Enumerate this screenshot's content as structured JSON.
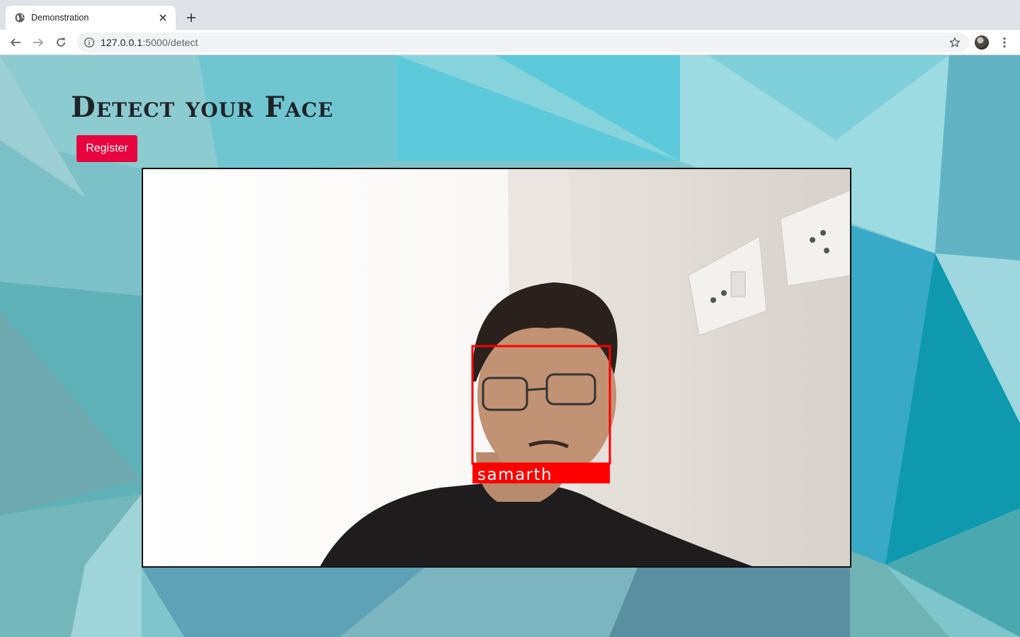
{
  "browser": {
    "tab_title": "Demonstration",
    "url_host": "127.0.0.1",
    "url_path": ":5000/detect"
  },
  "page": {
    "title": "Detect your Face",
    "register_label": "Register"
  },
  "detection": {
    "label": "samarth",
    "box_color": "#ff0000"
  },
  "colors": {
    "register_button": "#e8043f",
    "title_text": "#1f2327"
  }
}
